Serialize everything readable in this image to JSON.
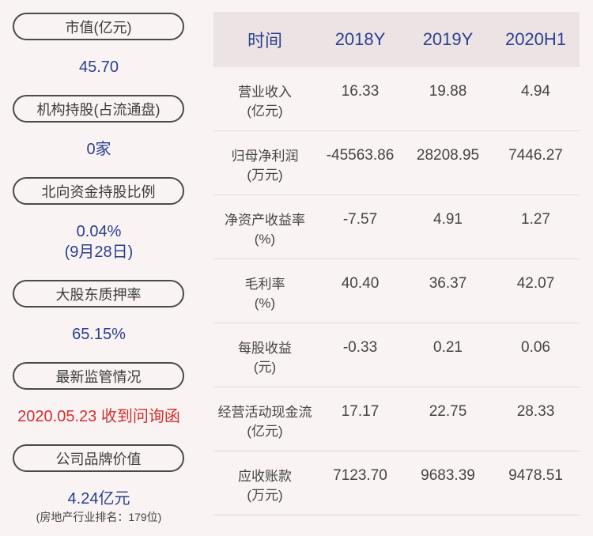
{
  "metrics": {
    "market_cap": {
      "label": "市值(亿元)",
      "value": "45.70"
    },
    "institutional": {
      "label": "机构持股(占流通盘)",
      "value": "0家"
    },
    "northbound": {
      "label": "北向资金持股比例",
      "value": "0.04%",
      "sub": "(9月28日)"
    },
    "pledge": {
      "label": "大股东质押率",
      "value": "65.15%"
    },
    "regulatory": {
      "label": "最新监管情况",
      "value": "2020.05.23 收到问询函"
    },
    "brand": {
      "label": "公司品牌价值",
      "value": "4.24亿元",
      "sub": "(房地产行业排名：179位)"
    }
  },
  "table": {
    "headers": [
      "时间",
      "2018Y",
      "2019Y",
      "2020H1"
    ],
    "rows": [
      {
        "label1": "营业收入",
        "label2": "(亿元)",
        "values": [
          "16.33",
          "19.88",
          "4.94"
        ]
      },
      {
        "label1": "归母净利润",
        "label2": "(万元)",
        "values": [
          "-45563.86",
          "28208.95",
          "7446.27"
        ]
      },
      {
        "label1": "净资产收益率",
        "label2": "(%)",
        "values": [
          "-7.57",
          "4.91",
          "1.27"
        ]
      },
      {
        "label1": "毛利率",
        "label2": "(%)",
        "values": [
          "40.40",
          "36.37",
          "42.07"
        ]
      },
      {
        "label1": "每股收益",
        "label2": "(元)",
        "values": [
          "-0.33",
          "0.21",
          "0.06"
        ]
      },
      {
        "label1": "经营活动现金流",
        "label2": "(亿元)",
        "values": [
          "17.17",
          "22.75",
          "28.33"
        ]
      },
      {
        "label1": "应收账款",
        "label2": "(万元)",
        "values": [
          "7123.70",
          "9683.39",
          "9478.51"
        ]
      }
    ]
  },
  "colors": {
    "background": "#f9f3f3",
    "value_blue": "#2b3f8e",
    "alert_red": "#d32f2f",
    "header_bg": "#ece4e4"
  }
}
